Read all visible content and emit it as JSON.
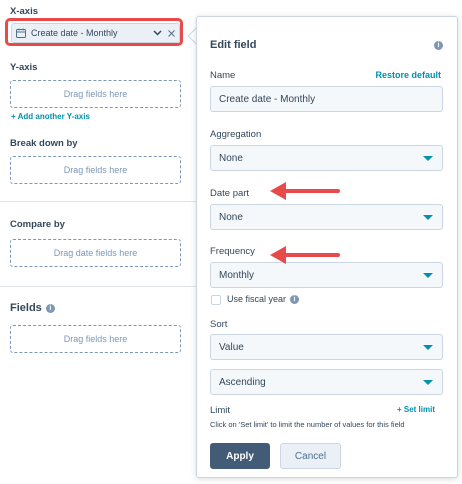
{
  "left": {
    "xaxis_label": "X-axis",
    "xaxis_pill": "Create date - Monthly",
    "yaxis_label": "Y-axis",
    "yaxis_drop": "Drag fields here",
    "add_y": "+ Add another Y-axis",
    "breakdown_label": "Break down by",
    "breakdown_drop": "Drag fields here",
    "compare_label": "Compare by",
    "compare_drop": "Drag date fields here",
    "fields_label": "Fields",
    "fields_drop": "Drag fields here"
  },
  "panel": {
    "title": "Edit field",
    "name_label": "Name",
    "restore": "Restore default",
    "name_value": "Create date - Monthly",
    "aggregation_label": "Aggregation",
    "aggregation_value": "None",
    "datepart_label": "Date part",
    "datepart_value": "None",
    "frequency_label": "Frequency",
    "frequency_value": "Monthly",
    "fiscal_label": "Use fiscal year",
    "sort_label": "Sort",
    "sort_value": "Value",
    "order_value": "Ascending",
    "limit_label": "Limit",
    "set_limit": "+ Set limit",
    "limit_help": "Click on 'Set limit' to limit the number of values for this field",
    "apply": "Apply",
    "cancel": "Cancel"
  },
  "colors": {
    "accent": "#0091ae",
    "highlight": "#e84a4a",
    "primary_button": "#425b76"
  },
  "icons": [
    "calendar-icon",
    "chevron-down-icon",
    "close-icon",
    "info-icon",
    "caret-down-icon",
    "red-arrow-annotation"
  ]
}
